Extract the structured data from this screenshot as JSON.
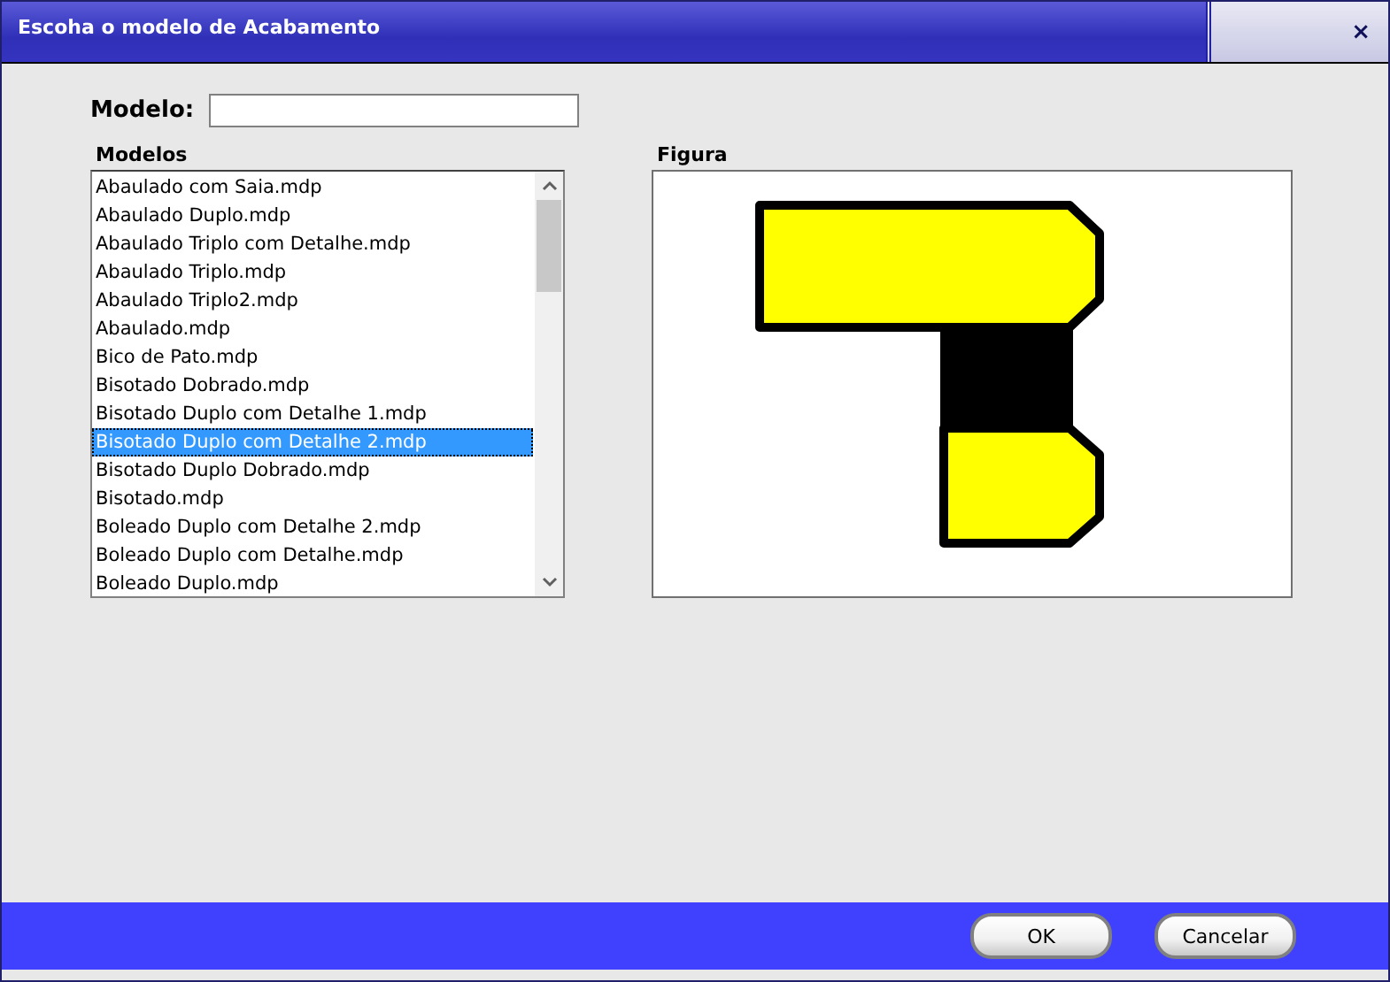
{
  "window": {
    "title": "Escoha o modelo de Acabamento",
    "close": "×"
  },
  "modelo": {
    "label": "Modelo:"
  },
  "modelos": {
    "label": "Modelos",
    "items": [
      {
        "label": "Abaulado com Saia.mdp",
        "selected": false
      },
      {
        "label": "Abaulado Duplo.mdp",
        "selected": false
      },
      {
        "label": "Abaulado Triplo com Detalhe.mdp",
        "selected": false
      },
      {
        "label": "Abaulado Triplo.mdp",
        "selected": false
      },
      {
        "label": "Abaulado Triplo2.mdp",
        "selected": false
      },
      {
        "label": "Abaulado.mdp",
        "selected": false
      },
      {
        "label": "Bico de Pato.mdp",
        "selected": false
      },
      {
        "label": "Bisotado Dobrado.mdp",
        "selected": false
      },
      {
        "label": "Bisotado Duplo com Detalhe 1.mdp",
        "selected": false
      },
      {
        "label": "Bisotado Duplo com Detalhe 2.mdp",
        "selected": true
      },
      {
        "label": "Bisotado Duplo Dobrado.mdp",
        "selected": false
      },
      {
        "label": "Bisotado.mdp",
        "selected": false
      },
      {
        "label": "Boleado Duplo com Detalhe 2.mdp",
        "selected": false
      },
      {
        "label": "Boleado Duplo com Detalhe.mdp",
        "selected": false
      },
      {
        "label": "Boleado Duplo.mdp",
        "selected": false
      }
    ]
  },
  "figura": {
    "label": "Figura"
  },
  "buttons": [
    "OK",
    "Cancelar"
  ]
}
